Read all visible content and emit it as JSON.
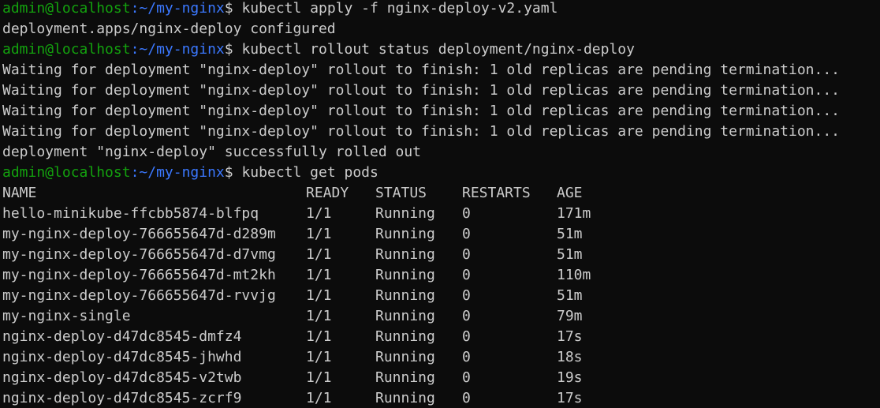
{
  "terminal": {
    "prompt": {
      "user_host": "admin@localhost",
      "path": ":~/my-nginx",
      "symbol": "$ "
    },
    "commands": [
      "kubectl apply -f nginx-deploy-v2.yaml",
      "kubectl rollout status deployment/nginx-deploy",
      "kubectl get pods"
    ],
    "apply_output": "deployment.apps/nginx-deploy configured",
    "rollout_output": [
      "Waiting for deployment \"nginx-deploy\" rollout to finish: 1 old replicas are pending termination...",
      "Waiting for deployment \"nginx-deploy\" rollout to finish: 1 old replicas are pending termination...",
      "Waiting for deployment \"nginx-deploy\" rollout to finish: 1 old replicas are pending termination...",
      "Waiting for deployment \"nginx-deploy\" rollout to finish: 1 old replicas are pending termination...",
      "deployment \"nginx-deploy\" successfully rolled out"
    ],
    "pods_table": {
      "headers": [
        "NAME",
        "READY",
        "STATUS",
        "RESTARTS",
        "AGE"
      ],
      "rows": [
        [
          "hello-minikube-ffcbb5874-blfpq",
          "1/1",
          "Running",
          "0",
          "171m"
        ],
        [
          "my-nginx-deploy-766655647d-d289m",
          "1/1",
          "Running",
          "0",
          "51m"
        ],
        [
          "my-nginx-deploy-766655647d-d7vmg",
          "1/1",
          "Running",
          "0",
          "51m"
        ],
        [
          "my-nginx-deploy-766655647d-mt2kh",
          "1/1",
          "Running",
          "0",
          "110m"
        ],
        [
          "my-nginx-deploy-766655647d-rvvjg",
          "1/1",
          "Running",
          "0",
          "51m"
        ],
        [
          "my-nginx-single",
          "1/1",
          "Running",
          "0",
          "79m"
        ],
        [
          "nginx-deploy-d47dc8545-dmfz4",
          "1/1",
          "Running",
          "0",
          "17s"
        ],
        [
          "nginx-deploy-d47dc8545-jhwhd",
          "1/1",
          "Running",
          "0",
          "18s"
        ],
        [
          "nginx-deploy-d47dc8545-v2twb",
          "1/1",
          "Running",
          "0",
          "19s"
        ],
        [
          "nginx-deploy-d47dc8545-zcrf9",
          "1/1",
          "Running",
          "0",
          "17s"
        ]
      ]
    },
    "colors": {
      "background": "#0c0c0c",
      "text": "#cccccc",
      "user_host": "#13a10e",
      "path": "#3b78ff"
    }
  }
}
